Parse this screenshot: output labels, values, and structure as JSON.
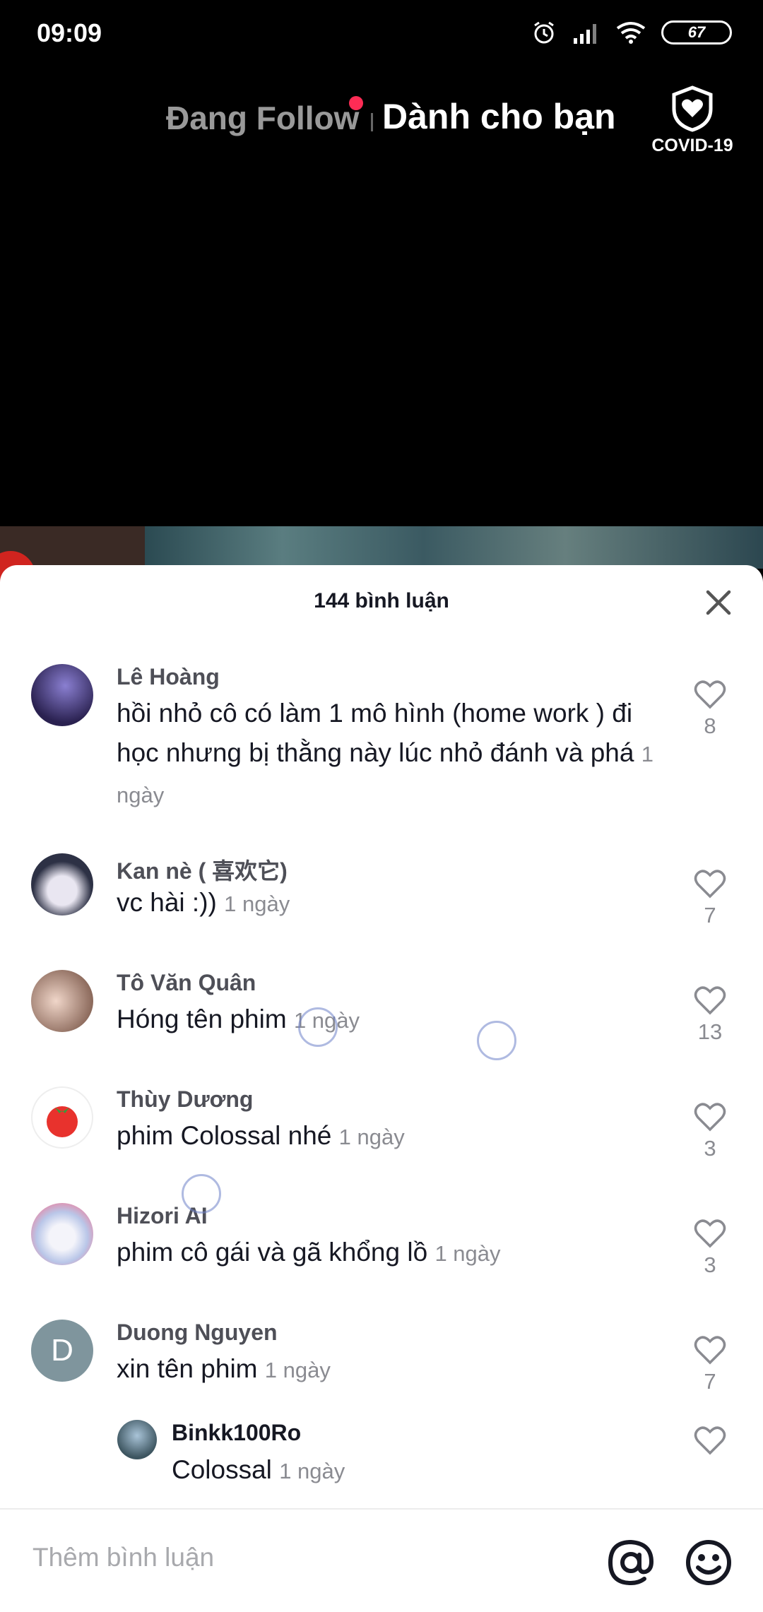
{
  "status_bar": {
    "time": "09:09",
    "battery": "67"
  },
  "top_nav": {
    "following": "Đang Follow",
    "for_you": "Dành cho bạn",
    "covid_label": "COVID-19"
  },
  "comments_panel": {
    "title": "144 bình luận",
    "comments": [
      {
        "user": "Lê Hoàng",
        "text": "hồi nhỏ cô có làm 1 mô hình (home work ) đi học nhưng bị thằng này lúc nhỏ đánh và phá",
        "time": "1 ngày",
        "likes": "8",
        "avatar_color": "#3b3470"
      },
      {
        "user": "Kan nè ( 喜欢它)",
        "text": "vc hài :))",
        "time": "1 ngày",
        "likes": "7",
        "avatar_color": "#2d3145"
      },
      {
        "user": "Tô Văn Quân",
        "text": "Hóng tên phim",
        "time": "1 ngày",
        "likes": "13",
        "avatar_color": "#c29a86"
      },
      {
        "user": "Thùy Dương",
        "text": "phim Colossal nhé",
        "time": "1 ngày",
        "likes": "3",
        "avatar_color": "#ffffff"
      },
      {
        "user": "Hizori AI",
        "text": "phim cô gái và gã khổng lồ",
        "time": "1 ngày",
        "likes": "3",
        "avatar_color": "#c8d7f0"
      },
      {
        "user": "Duong Nguyen",
        "text": "xin tên phim",
        "time": "1 ngày",
        "likes": "7",
        "avatar_letter": "D",
        "avatar_color": "#7f959d"
      }
    ],
    "reply": {
      "user": "Binkk100Ro",
      "text": "Colossal",
      "time": "1 ngày"
    }
  },
  "input": {
    "placeholder": "Thêm bình luận"
  },
  "colors": {
    "accent_red": "#fe2c55",
    "text_dark": "#161823",
    "text_muted": "#8a8b91"
  }
}
